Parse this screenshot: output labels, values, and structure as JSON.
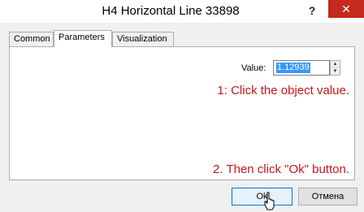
{
  "window": {
    "title": "H4 Horizontal Line 33898",
    "help_label": "?",
    "close_label": "✕"
  },
  "tabs": [
    {
      "label": "Common",
      "active": false
    },
    {
      "label": "Parameters",
      "active": true
    },
    {
      "label": "Visualization",
      "active": false
    }
  ],
  "parameters": {
    "value_label": "Value:",
    "value": "1.12939"
  },
  "annotations": {
    "step1": "1: Click the object value.",
    "step2": "2. Then click \"Ok\" button."
  },
  "buttons": {
    "ok_label": "Ok",
    "cancel_label": "Отмена"
  },
  "colors": {
    "annotation": "#c4161c",
    "close_button": "#c42b1c",
    "selection": "#3399ff"
  }
}
